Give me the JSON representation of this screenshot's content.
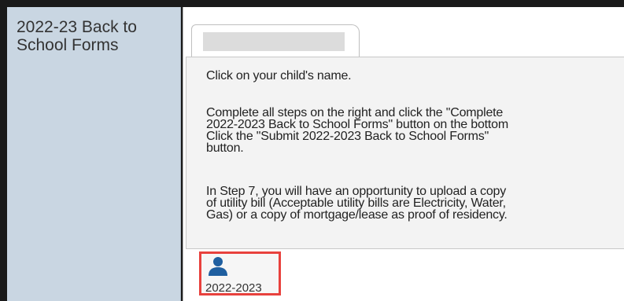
{
  "sidebar": {
    "title": "2022-23 Back to School Forms"
  },
  "instructions": {
    "line1": "Click on your child's name.",
    "line2": "Complete all steps on the right and click the \"Complete\n2022-2023 Back to School Forms\" button on the bottom\nClick the \"Submit 2022-2023 Back to School Forms\"\nbutton.",
    "line3": "In Step 7, you will have an opportunity to upload a copy\nof utility bill (Acceptable utility bills are Electricity, Water,\nGas) or a copy of mortgage/lease as proof of residency."
  },
  "student": {
    "year_label": "2022-2023",
    "icon": "person-icon",
    "icon_color": "#1f5fa0"
  },
  "colors": {
    "highlight": "#e8413d",
    "sidebar_bg": "#c9d6e2"
  }
}
